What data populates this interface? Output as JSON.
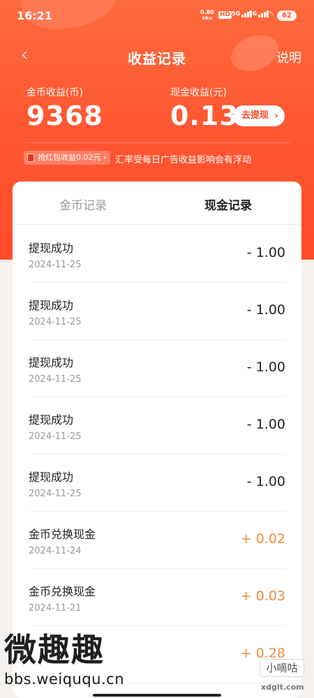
{
  "status_bar": {
    "time": "16:21",
    "net_speed_value": "0.80",
    "net_speed_unit": "KB/s",
    "hd_label": "HD",
    "signal1_label": "5G",
    "signal2_label": "5G",
    "battery": "62"
  },
  "nav": {
    "back_icon": "chevron-left-icon",
    "title": "收益记录",
    "help_label": "说明"
  },
  "summary": {
    "coin_label": "金币收益(币)",
    "coin_value": "9368",
    "cash_label": "现金收益(元)",
    "cash_value": "0.13",
    "withdraw_label": "去提现"
  },
  "info": {
    "pill_text": "抢红包收益0.02元",
    "notice": "汇率受每日广告收益影响会有浮动"
  },
  "tabs": [
    {
      "label": "金币记录",
      "active": false
    },
    {
      "label": "现金记录",
      "active": true
    }
  ],
  "records": [
    {
      "title": "提现成功",
      "date": "2024-11-25",
      "amount": "- 1.00"
    },
    {
      "title": "提现成功",
      "date": "2024-11-25",
      "amount": "- 1.00"
    },
    {
      "title": "提现成功",
      "date": "2024-11-25",
      "amount": "- 1.00"
    },
    {
      "title": "提现成功",
      "date": "2024-11-25",
      "amount": "- 1.00"
    },
    {
      "title": "提现成功",
      "date": "2024-11-25",
      "amount": "- 1.00"
    },
    {
      "title": "金币兑换现金",
      "date": "2024-11-24",
      "amount": "+ 0.02"
    },
    {
      "title": "金币兑换现金",
      "date": "2024-11-21",
      "amount": "+ 0.03"
    },
    {
      "title": "",
      "date": "",
      "amount": "+ 0.28"
    }
  ],
  "watermarks": {
    "left_big": "微趣趣",
    "left_url": "bbs.weiququ.cn",
    "right_box": "小嘀咕",
    "right_site": "xdglt.com"
  },
  "colors": {
    "accent": "#ff5530",
    "positive_amount": "#f08a3b"
  }
}
